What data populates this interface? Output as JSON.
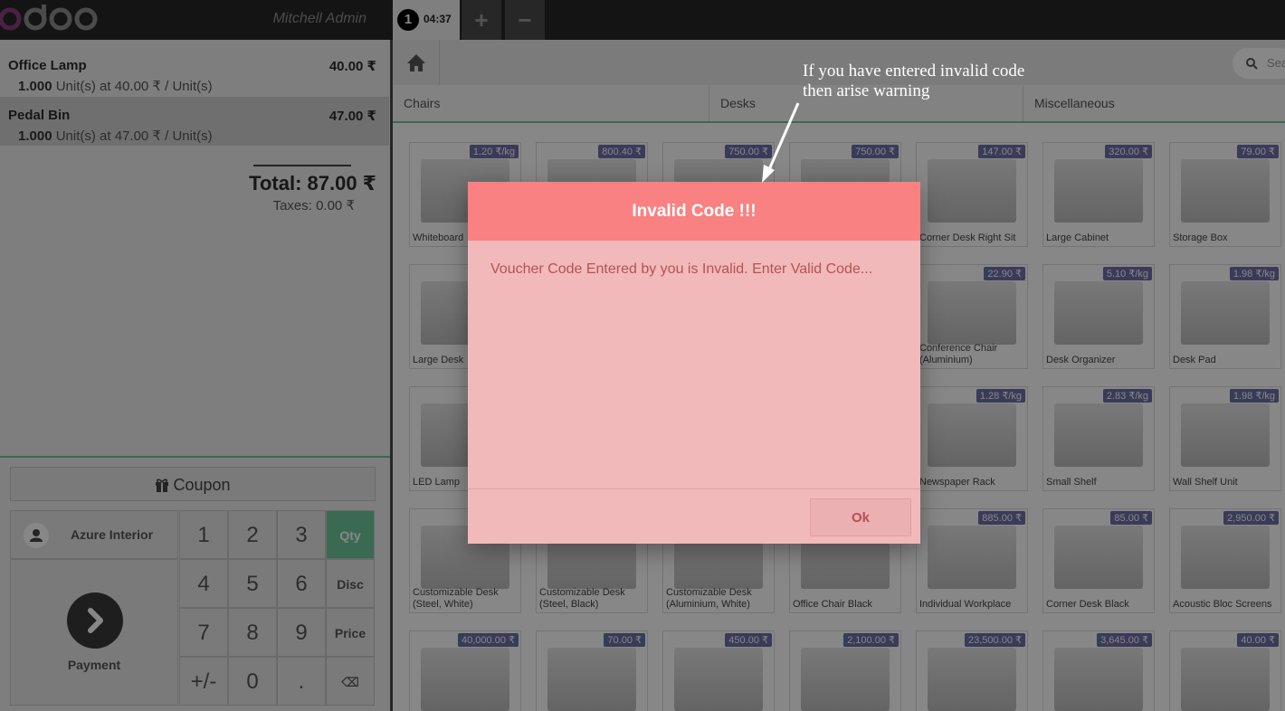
{
  "header": {
    "logo": "odoo",
    "user": "Mitchell Admin",
    "order_number": "1",
    "order_time": "04:37",
    "add_order": "+",
    "remove_order": "−"
  },
  "order": {
    "lines": [
      {
        "name": "Office Lamp",
        "price": "40.00 ₹",
        "qty": "1.000",
        "detail": " Unit(s) at 40.00 ₹ / Unit(s)"
      },
      {
        "name": "Pedal Bin",
        "price": "47.00 ₹",
        "qty": "1.000",
        "detail": " Unit(s) at 47.00 ₹ / Unit(s)"
      }
    ],
    "total": "Total: 87.00 ₹",
    "taxes": "Taxes: 0.00 ₹"
  },
  "actions": {
    "coupon": "Coupon",
    "customer": "Azure Interior",
    "payment": "Payment"
  },
  "numpad": {
    "keys": [
      "1",
      "2",
      "3",
      "Qty",
      "4",
      "5",
      "6",
      "Disc",
      "7",
      "8",
      "9",
      "Price",
      "+/-",
      "0",
      ".",
      "⌫"
    ],
    "active_mode": "Qty"
  },
  "categories": [
    "Chairs",
    "Desks",
    "Miscellaneous"
  ],
  "search": {
    "placeholder": "Sea"
  },
  "products": [
    {
      "name": "Whiteboard",
      "price": "1.20 ₹/kg"
    },
    {
      "name": "",
      "price": "800.40 ₹"
    },
    {
      "name": "",
      "price": "750.00 ₹"
    },
    {
      "name": "",
      "price": "750.00 ₹"
    },
    {
      "name": "Corner Desk Right Sit",
      "price": "147.00 ₹"
    },
    {
      "name": "Large Cabinet",
      "price": "320.00 ₹"
    },
    {
      "name": "Storage Box",
      "price": "79.00 ₹"
    },
    {
      "name": "Large Desk",
      "price": ""
    },
    {
      "name": "",
      "price": ""
    },
    {
      "name": "",
      "price": ""
    },
    {
      "name": "",
      "price": ""
    },
    {
      "name": "Conference Chair (Aluminium)",
      "price": "22.90 ₹"
    },
    {
      "name": "Desk Organizer",
      "price": "5.10 ₹/kg"
    },
    {
      "name": "Desk Pad",
      "price": "1.98 ₹/kg"
    },
    {
      "name": "LED Lamp",
      "price": ""
    },
    {
      "name": "",
      "price": ""
    },
    {
      "name": "",
      "price": ""
    },
    {
      "name": "",
      "price": ""
    },
    {
      "name": "Newspaper Rack",
      "price": "1.28 ₹/kg"
    },
    {
      "name": "Small Shelf",
      "price": "2.83 ₹/kg"
    },
    {
      "name": "Wall Shelf Unit",
      "price": "1.98 ₹/kg"
    },
    {
      "name": "Customizable Desk (Steel, White)",
      "price": ""
    },
    {
      "name": "Customizable Desk (Steel, Black)",
      "price": ""
    },
    {
      "name": "Customizable Desk (Aluminium, White)",
      "price": ""
    },
    {
      "name": "Office Chair Black",
      "price": ""
    },
    {
      "name": "Individual Workplace",
      "price": "885.00 ₹"
    },
    {
      "name": "Corner Desk Black",
      "price": "85.00 ₹"
    },
    {
      "name": "Acoustic Bloc Screens",
      "price": "2,950.00 ₹"
    },
    {
      "name": "",
      "price": "40,000.00 ₹"
    },
    {
      "name": "",
      "price": "70.00 ₹"
    },
    {
      "name": "",
      "price": "450.00 ₹"
    },
    {
      "name": "",
      "price": "2,100.00 ₹"
    },
    {
      "name": "",
      "price": "23,500.00 ₹"
    },
    {
      "name": "",
      "price": "3,645.00 ₹"
    },
    {
      "name": "",
      "price": "40.00 ₹"
    }
  ],
  "modal": {
    "title": "Invalid Code !!!",
    "body": "Voucher Code Entered by you is Invalid. Enter Valid Code...",
    "ok": "Ok"
  },
  "annotation": {
    "line1": "If you have entered invalid code",
    "line2": "then arise warning"
  },
  "colors": {
    "accent": "#6ec89b",
    "modal_header": "#f98181",
    "modal_body": "#f2b9bb",
    "price_badge": "#6e6ea8"
  }
}
